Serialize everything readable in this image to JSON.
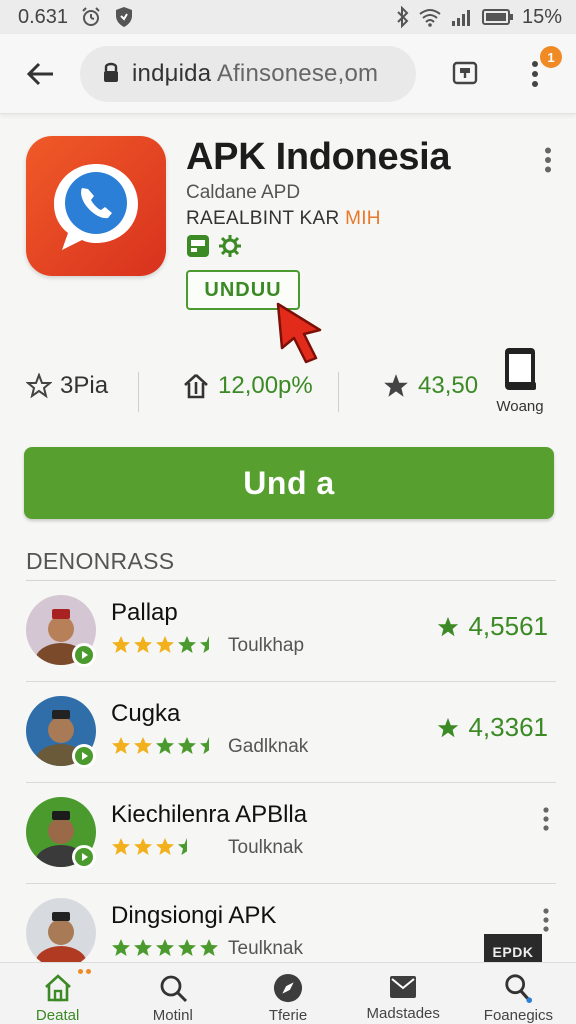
{
  "status_bar": {
    "speed": "0.631",
    "battery": "15%"
  },
  "browser": {
    "url_main": "indμida",
    "url_rest": "Afinsonese,om",
    "notification_count": "1"
  },
  "app": {
    "title": "APK Indonesia",
    "developer": "Caldane APD",
    "category_main": "RAEALBINT KAR",
    "category_accent": "MIH",
    "install_small_label": "UNDUU",
    "main_install_label": "Und a"
  },
  "stats": {
    "rating_label": "3Pia",
    "downloads": "12,00p%",
    "score": "43,50",
    "device_label": "Woang"
  },
  "section": {
    "title": "DENONRASS"
  },
  "list": [
    {
      "name": "Pallap",
      "stars_text": "★★★★½",
      "sub": "Toulkhap",
      "rating": "4,5561",
      "avatar_bg": "#c9b8c6"
    },
    {
      "name": "Cugka",
      "stars_text": "★★★★½",
      "sub": "Gadlknak",
      "rating": "4,3361",
      "avatar_bg": "#2f6ea8"
    },
    {
      "name": "Kiechilenra APBlla",
      "stars_text": "★★★½",
      "sub": "Toulknak",
      "rating": "",
      "avatar_bg": "#4a9a2e"
    },
    {
      "name": "Dingsiongi APK",
      "stars_text": "★★★★★",
      "sub": "Teulknak",
      "rating": "",
      "avatar_bg": "#d7dbe0",
      "thumb": "EPDK"
    }
  ],
  "nav": {
    "items": [
      "Deatal",
      "Motinl",
      "Tferie",
      "Madstades",
      "Foanegics"
    ]
  },
  "colors": {
    "accent_green": "#57a02f",
    "text_green": "#3b8a25",
    "icon_red": "#e03c22",
    "star_gold": "#f2b11c"
  }
}
